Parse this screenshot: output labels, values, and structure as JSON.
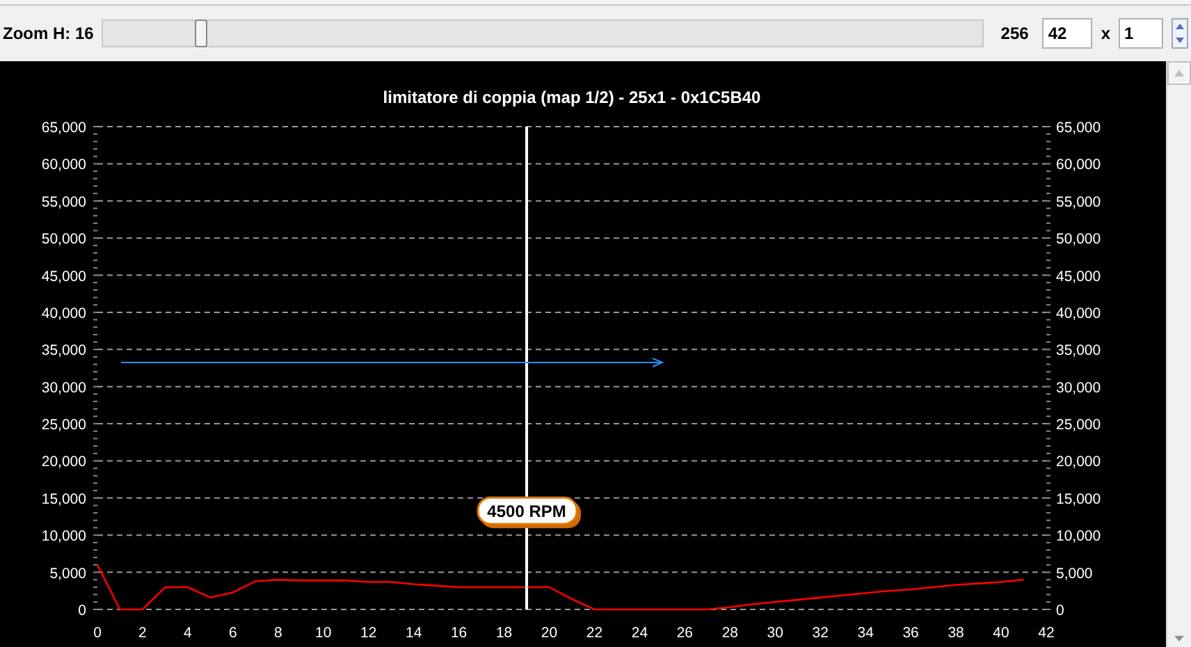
{
  "toolbar": {
    "zoom_label": "Zoom H: 16",
    "slider": {
      "level": 0.11
    },
    "max_label": "256",
    "width_value": "42",
    "times": "x",
    "height_value": "1"
  },
  "chart": {
    "chart_data": {
      "type": "line",
      "title": "limitatore di coppia (map 1/2) - 25x1 - 0x1C5B40",
      "x": [
        0,
        1,
        2,
        3,
        4,
        5,
        6,
        7,
        8,
        9,
        10,
        11,
        12,
        13,
        14,
        15,
        16,
        17,
        18,
        19,
        20,
        21,
        22,
        23,
        24,
        25,
        26,
        27,
        28,
        29,
        30,
        31,
        32,
        33,
        34,
        35,
        36,
        37,
        38,
        39,
        40,
        41
      ],
      "series": [
        {
          "color": "#ff0000",
          "values": [
            6000,
            0,
            0,
            3000,
            3000,
            1600,
            2300,
            3800,
            4000,
            3900,
            3900,
            3900,
            3700,
            3700,
            3400,
            3200,
            3000,
            3000,
            3000,
            3000,
            3000,
            1400,
            0,
            0,
            0,
            0,
            0,
            0,
            300,
            700,
            1000,
            1300,
            1600,
            1900,
            2200,
            2500,
            2700,
            3000,
            3300,
            3500,
            3700,
            4000
          ]
        }
      ],
      "xlim": [
        0,
        42
      ],
      "ylim": [
        0,
        65000
      ],
      "y2lim": [
        0,
        65000
      ],
      "grid": true,
      "xticks": [
        0,
        2,
        4,
        6,
        8,
        10,
        12,
        14,
        16,
        18,
        20,
        22,
        24,
        26,
        28,
        30,
        32,
        34,
        36,
        38,
        40,
        42
      ],
      "yticks": [
        {
          "value": 0,
          "label": "0"
        },
        {
          "value": 5000,
          "label": "5,000"
        },
        {
          "value": 10000,
          "label": "10,000"
        },
        {
          "value": 15000,
          "label": "15,000"
        },
        {
          "value": 20000,
          "label": "20,000"
        },
        {
          "value": 25000,
          "label": "25,000"
        },
        {
          "value": 30000,
          "label": "30,000"
        },
        {
          "value": 35000,
          "label": "35,000"
        },
        {
          "value": 40000,
          "label": "40,000"
        },
        {
          "value": 45000,
          "label": "45,000"
        },
        {
          "value": 50000,
          "label": "50,000"
        },
        {
          "value": 55000,
          "label": "55,000"
        },
        {
          "value": 60000,
          "label": "60,000"
        },
        {
          "value": 65000,
          "label": "65,000"
        }
      ],
      "y2ticks": [
        {
          "value": 0,
          "label": "0"
        },
        {
          "value": 5000,
          "label": "5,000"
        },
        {
          "value": 10000,
          "label": "10,000"
        },
        {
          "value": 15000,
          "label": "15,000"
        },
        {
          "value": 20000,
          "label": "20,000"
        },
        {
          "value": 25000,
          "label": "25,000"
        },
        {
          "value": 30000,
          "label": "30,000"
        },
        {
          "value": 35000,
          "label": "35,000"
        },
        {
          "value": 40000,
          "label": "40,000"
        },
        {
          "value": 45000,
          "label": "45,000"
        },
        {
          "value": 50000,
          "label": "50,000"
        },
        {
          "value": 55000,
          "label": "55,000"
        },
        {
          "value": 60000,
          "label": "60,000"
        },
        {
          "value": 65000,
          "label": "65,000"
        }
      ],
      "ref_lines": [
        {
          "axis": "x",
          "value": 19,
          "color": "#ffffff"
        }
      ],
      "annotations": [
        {
          "text": "4500 RPM",
          "x": 19,
          "y": 13000
        }
      ]
    }
  }
}
